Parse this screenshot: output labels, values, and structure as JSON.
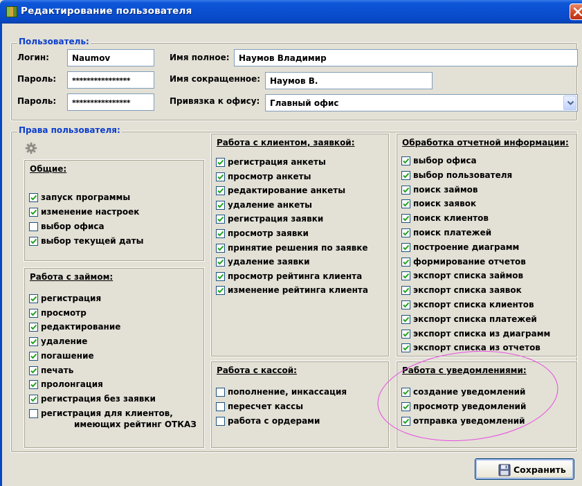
{
  "window": {
    "title": "Редактирование пользователя"
  },
  "user": {
    "legend": "Пользователь:",
    "login_label": "Логин:",
    "login_value": "Naumov",
    "password_label": "Пароль:",
    "password_value": "****************",
    "password2_label": "Пароль:",
    "password2_value": "****************",
    "fullname_label": "Имя полное:",
    "fullname_value": "Наумов Владимир",
    "shortname_label": "Имя сокращенное:",
    "shortname_value": "Наумов В.",
    "office_label": "Привязка к офису:",
    "office_value": "Главный офис"
  },
  "rights": {
    "legend": "Права пользователя:",
    "general": {
      "title": "Общие:",
      "items": [
        {
          "label": "запуск программы",
          "checked": true
        },
        {
          "label": "изменение настроек",
          "checked": true
        },
        {
          "label": "выбор офиса",
          "checked": false
        },
        {
          "label": "выбор текущей даты",
          "checked": true
        }
      ]
    },
    "loan": {
      "title": "Работа с займом:",
      "items": [
        {
          "label": "регистрация",
          "checked": true
        },
        {
          "label": "просмотр",
          "checked": true
        },
        {
          "label": "редактирование",
          "checked": true
        },
        {
          "label": "удаление",
          "checked": true
        },
        {
          "label": "погашение",
          "checked": true
        },
        {
          "label": "печать",
          "checked": true
        },
        {
          "label": "пролонгация",
          "checked": true
        },
        {
          "label": "регистрация без заявки",
          "checked": true
        },
        {
          "label": "регистрация для клиентов,",
          "checked": false
        }
      ],
      "last_line2": "имеющих рейтинг ОТКАЗ"
    },
    "client": {
      "title": "Работа с клиентом, заявкой:",
      "items": [
        {
          "label": "регистрация анкеты",
          "checked": true
        },
        {
          "label": "просмотр анкеты",
          "checked": true
        },
        {
          "label": "редактирование анкеты",
          "checked": true
        },
        {
          "label": "удаление анкеты",
          "checked": true
        },
        {
          "label": "регистрация заявки",
          "checked": true
        },
        {
          "label": "просмотр заявки",
          "checked": true
        },
        {
          "label": "принятие решения по заявке",
          "checked": true
        },
        {
          "label": "удаление заявки",
          "checked": true
        },
        {
          "label": "просмотр рейтинга клиента",
          "checked": true
        },
        {
          "label": "изменение рейтинга клиента",
          "checked": true
        }
      ]
    },
    "cash": {
      "title": "Работа с кассой:",
      "items": [
        {
          "label": "пополнение, инкассация",
          "checked": false
        },
        {
          "label": "пересчет кассы",
          "checked": false
        },
        {
          "label": "работа с ордерами",
          "checked": false
        }
      ]
    },
    "reports": {
      "title": "Обработка отчетной информации:",
      "items": [
        {
          "label": "выбор офиса",
          "checked": true
        },
        {
          "label": "выбор пользователя",
          "checked": true
        },
        {
          "label": "поиск займов",
          "checked": true
        },
        {
          "label": "поиск заявок",
          "checked": true
        },
        {
          "label": "поиск клиентов",
          "checked": true
        },
        {
          "label": "поиск платежей",
          "checked": true
        },
        {
          "label": "построение диаграмм",
          "checked": true
        },
        {
          "label": "формирование отчетов",
          "checked": true
        },
        {
          "label": "экспорт списка займов",
          "checked": true
        },
        {
          "label": "экспорт списка заявок",
          "checked": true
        },
        {
          "label": "экспорт списка клиентов",
          "checked": true
        },
        {
          "label": "экспорт списка платежей",
          "checked": true
        },
        {
          "label": "экспорт списка из диаграмм",
          "checked": true
        },
        {
          "label": "экспорт списка из отчетов",
          "checked": true
        }
      ]
    },
    "notifications": {
      "title": "Работа с уведомлениями:",
      "items": [
        {
          "label": "создание уведомлений",
          "checked": true
        },
        {
          "label": "просмотр уведомлений",
          "checked": true
        },
        {
          "label": "отправка уведомлений",
          "checked": true
        }
      ]
    }
  },
  "buttons": {
    "save_label": "Сохранить"
  },
  "colors": {
    "titlebar": "#0a4fd0",
    "legend": "#0b3ecc",
    "highlight_ellipse": "#e74be0"
  }
}
